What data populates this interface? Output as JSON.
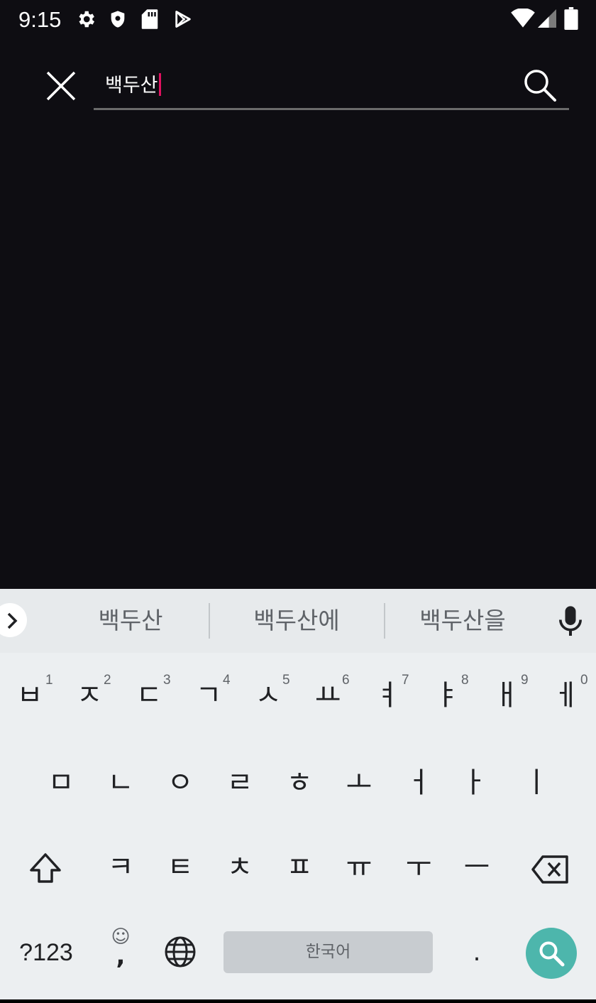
{
  "status_bar": {
    "time": "9:15",
    "left_icons": [
      "settings-icon",
      "shield-icon",
      "sd-card-icon",
      "play-store-icon"
    ],
    "right_icons": [
      "wifi-icon",
      "signal-icon",
      "battery-icon"
    ]
  },
  "search": {
    "query": "백두산",
    "close_icon": "close-icon",
    "search_icon": "search-icon",
    "underline_color": "#6a6a6a",
    "caret_color": "#e0115f"
  },
  "keyboard": {
    "suggestions": [
      "백두산",
      "백두산에",
      "백두산을"
    ],
    "row1": [
      {
        "key": "ㅂ",
        "hint": "1"
      },
      {
        "key": "ㅈ",
        "hint": "2"
      },
      {
        "key": "ㄷ",
        "hint": "3"
      },
      {
        "key": "ㄱ",
        "hint": "4"
      },
      {
        "key": "ㅅ",
        "hint": "5"
      },
      {
        "key": "ㅛ",
        "hint": "6"
      },
      {
        "key": "ㅕ",
        "hint": "7"
      },
      {
        "key": "ㅑ",
        "hint": "8"
      },
      {
        "key": "ㅐ",
        "hint": "9"
      },
      {
        "key": "ㅔ",
        "hint": "0"
      }
    ],
    "row2": [
      "ㅁ",
      "ㄴ",
      "ㅇ",
      "ㄹ",
      "ㅎ",
      "ㅗ",
      "ㅓ",
      "ㅏ",
      "ㅣ"
    ],
    "row3": [
      "ㅋ",
      "ㅌ",
      "ㅊ",
      "ㅍ",
      "ㅠ",
      "ㅜ",
      "ㅡ"
    ],
    "symbols_label": "?123",
    "emoji_hint": "☺",
    "comma_label": ",",
    "space_label": "한국어",
    "period_label": ".",
    "enter_color": "#4db6ac"
  }
}
